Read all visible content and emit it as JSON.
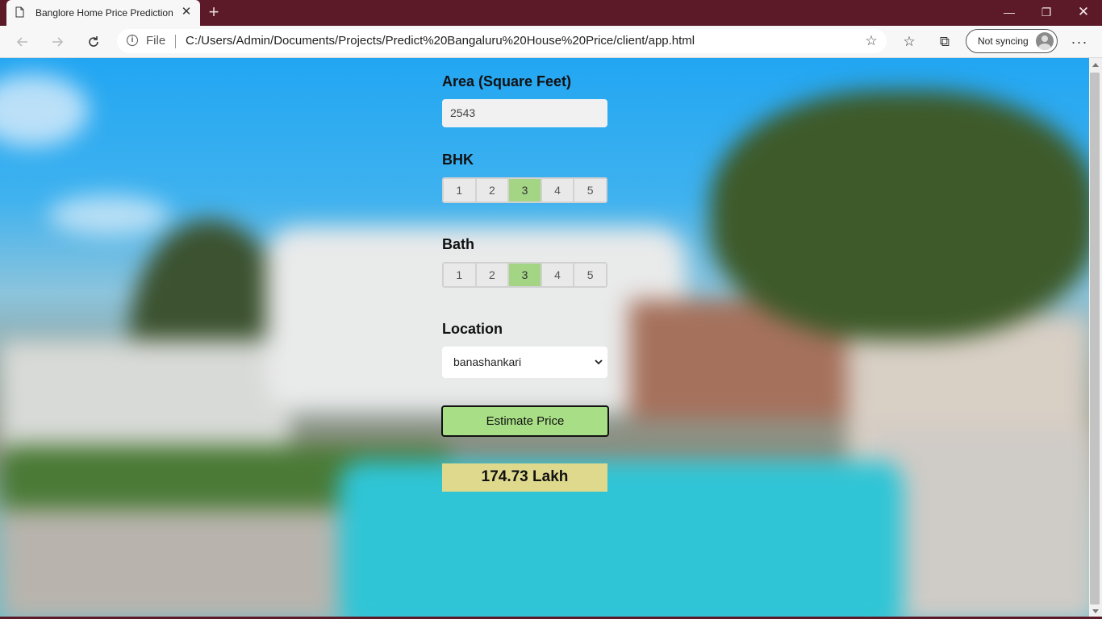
{
  "browser": {
    "tab_title": "Banglore Home Price Prediction",
    "tab_close": "✕",
    "new_tab": "+",
    "scheme_label": "File",
    "url": "C:/Users/Admin/Documents/Projects/Predict%20Bangaluru%20House%20Price/client/app.html",
    "profile_label": "Not syncing",
    "window_controls": {
      "minimize": "—",
      "maximize": "❐",
      "close": "✕"
    },
    "more": "···"
  },
  "form": {
    "area_label": "Area (Square Feet)",
    "area_value": "2543",
    "bhk_label": "BHK",
    "bhk_options": [
      "1",
      "2",
      "3",
      "4",
      "5"
    ],
    "bhk_selected": "3",
    "bath_label": "Bath",
    "bath_options": [
      "1",
      "2",
      "3",
      "4",
      "5"
    ],
    "bath_selected": "3",
    "location_label": "Location",
    "location_value": "banashankari",
    "estimate_button": "Estimate Price",
    "result": "174.73 Lakh"
  },
  "colors": {
    "titlebar": "#5c1a28",
    "selected_option": "#a3d585",
    "estimate_button": "#a8de86",
    "result_background": "#ded98c"
  }
}
